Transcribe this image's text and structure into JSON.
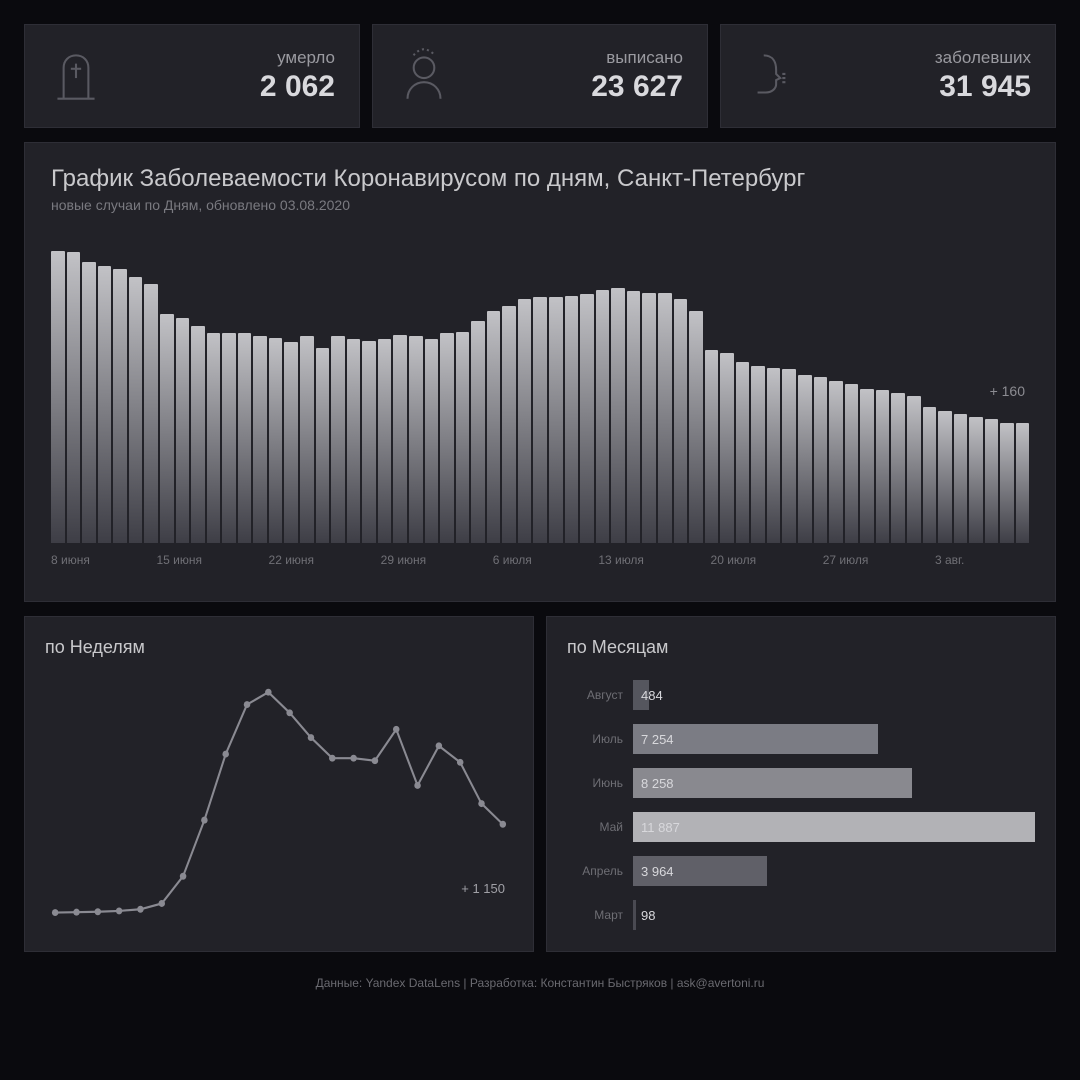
{
  "cards": [
    {
      "icon": "grave-icon",
      "label": "умерло",
      "value": "2 062"
    },
    {
      "icon": "person-icon",
      "label": "выписано",
      "value": "23 627"
    },
    {
      "icon": "cough-icon",
      "label": "заболевших",
      "value": "31 945"
    }
  ],
  "main": {
    "title": "График Заболеваемости Коронавирусом по дням, Санкт-Петербург",
    "subtitle": "новые случаи по Дням, обновлено 03.08.2020",
    "annotation": "+ 160"
  },
  "weekly": {
    "title": "по Неделям",
    "annotation": "+ 1 150"
  },
  "monthly": {
    "title": "по Месяцам"
  },
  "footer": "Данные: Yandex DataLens | Разработка: Константин Быстряков | ask@avertoni.ru",
  "chart_data": [
    {
      "type": "bar",
      "title": "График Заболеваемости Коронавирусом по дням, Санкт-Петербург",
      "subtitle": "новые случаи по Дням, обновлено 03.08.2020",
      "x_ticks": [
        "8 июня",
        "15 июня",
        "22 июня",
        "29 июня",
        "6 июля",
        "13 июля",
        "20 июля",
        "27 июля",
        "3 авг."
      ],
      "values": [
        390,
        388,
        375,
        370,
        365,
        355,
        345,
        305,
        300,
        290,
        280,
        280,
        280,
        276,
        274,
        268,
        276,
        260,
        276,
        272,
        270,
        272,
        278,
        276,
        272,
        280,
        282,
        296,
        310,
        316,
        326,
        328,
        328,
        330,
        332,
        338,
        340,
        336,
        334,
        334,
        326,
        310,
        258,
        254,
        242,
        236,
        234,
        232,
        224,
        222,
        216,
        212,
        206,
        204,
        200,
        196,
        182,
        176,
        172,
        168,
        165,
        160,
        160
      ],
      "ylim": [
        0,
        400
      ],
      "last_value_annotation": "+ 160"
    },
    {
      "type": "line",
      "title": "по Неделям",
      "x_index": [
        1,
        2,
        3,
        4,
        5,
        6,
        7,
        8,
        9,
        10,
        11,
        12,
        13,
        14,
        15,
        16,
        17,
        18,
        19,
        20,
        21,
        22
      ],
      "values": [
        80,
        85,
        90,
        100,
        120,
        190,
        520,
        1200,
        2000,
        2600,
        2750,
        2500,
        2200,
        1950,
        1950,
        1920,
        2300,
        1620,
        2100,
        1900,
        1400,
        1150
      ],
      "last_value_annotation": "+ 1 150"
    },
    {
      "type": "bar",
      "orientation": "horizontal",
      "title": "по Месяцам",
      "categories": [
        "Август",
        "Июль",
        "Июнь",
        "Май",
        "Апрель",
        "Март"
      ],
      "values": [
        484,
        7254,
        8258,
        11887,
        3964,
        98
      ]
    }
  ]
}
